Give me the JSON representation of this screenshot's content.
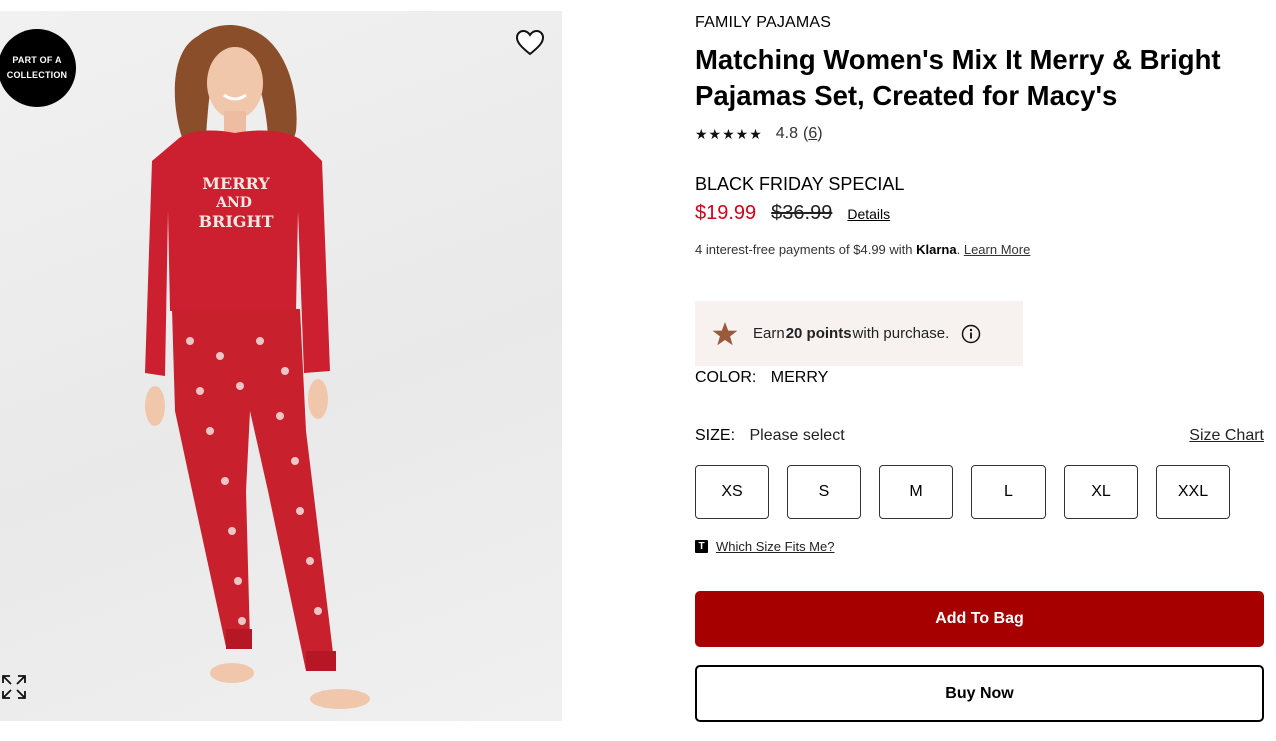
{
  "image": {
    "badge_line1": "PART OF A",
    "badge_line2": "COLLECTION",
    "shirt_text": [
      "MERRY",
      "AND",
      "BRIGHT"
    ],
    "wishlist_icon": "heart-outline-icon",
    "zoom_icon": "expand-arrows-icon"
  },
  "product": {
    "brand": "FAMILY PAJAMAS",
    "title": "Matching Women's Mix It Merry & Bright Pajamas Set, Created for Macy's",
    "stars": "★★★★★",
    "rating": "4.8",
    "review_count_prefix": "(",
    "review_count": "6",
    "review_count_suffix": ")"
  },
  "pricing": {
    "promo_label": "BLACK FRIDAY SPECIAL",
    "sale_price": "$19.99",
    "original_price": "$36.99",
    "details_label": "Details",
    "klarna_text": "4 interest-free payments of $4.99 with ",
    "klarna_brand": "Klarna",
    "klarna_dot": ".",
    "learn_more": "Learn More",
    "sale_color": "#d0021b"
  },
  "points": {
    "prefix": "Earn ",
    "amount": "20 points",
    "suffix": " with purchase.",
    "star_color": "#9c5a3c"
  },
  "color": {
    "label": "COLOR:",
    "value": "MERRY"
  },
  "size": {
    "label": "SIZE:",
    "value": "Please select",
    "chart_label": "Size Chart",
    "options": [
      "XS",
      "S",
      "M",
      "L",
      "XL",
      "XXL"
    ]
  },
  "fit": {
    "icon_letter": "T",
    "link": "Which Size Fits Me?"
  },
  "actions": {
    "add_to_bag": "Add To Bag",
    "buy_now": "Buy Now",
    "accent": "#a70000"
  }
}
